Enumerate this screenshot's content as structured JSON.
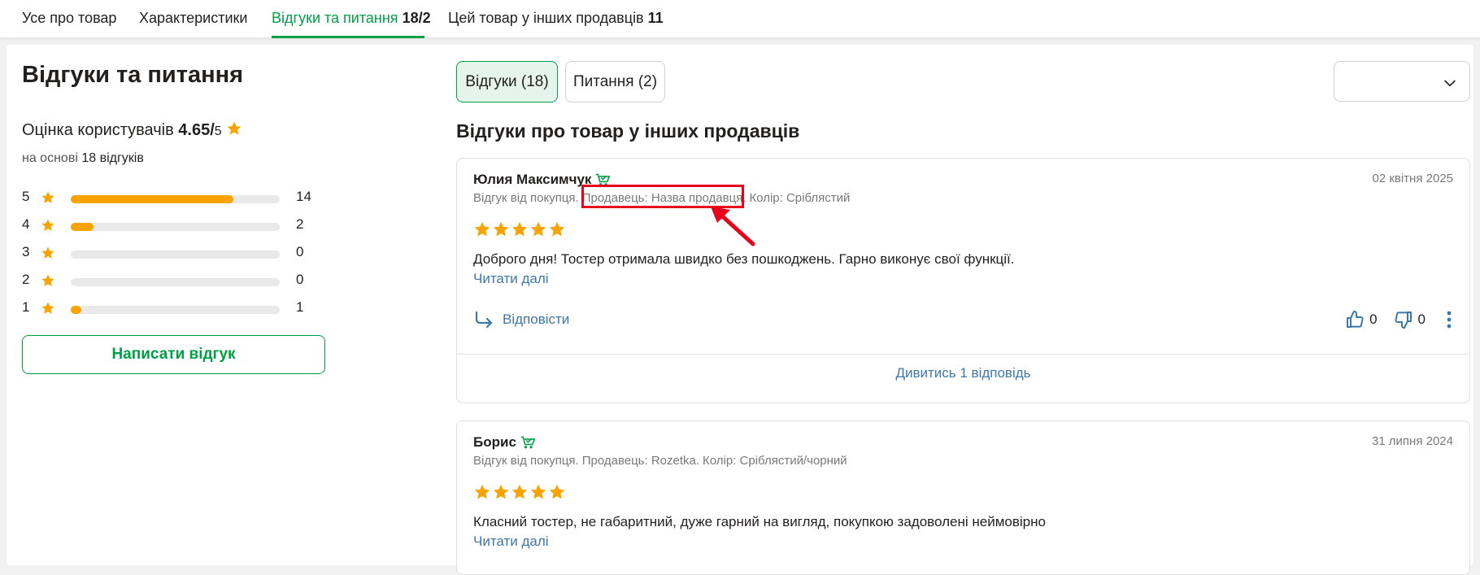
{
  "tabs": [
    {
      "label": "Усе про товар",
      "count": ""
    },
    {
      "label": "Характеристики",
      "count": ""
    },
    {
      "label": "Відгуки та питання",
      "count": "18/2"
    },
    {
      "label": "Цей товар у інших продавців",
      "count": "11"
    }
  ],
  "summary": {
    "title": "Відгуки та питання",
    "rating_label": "Оцінка користувачів",
    "rating_value": "4.65/",
    "rating_max": "5",
    "basis_prefix": "на основі",
    "basis_count": "18 відгуків",
    "distribution": [
      {
        "stars": "5",
        "count": "14",
        "fraction": 0.78
      },
      {
        "stars": "4",
        "count": "2",
        "fraction": 0.11
      },
      {
        "stars": "3",
        "count": "0",
        "fraction": 0
      },
      {
        "stars": "2",
        "count": "0",
        "fraction": 0
      },
      {
        "stars": "1",
        "count": "1",
        "fraction": 0.05
      }
    ],
    "write_button": "Написати відгук"
  },
  "filters": {
    "reviews": "Відгуки (18)",
    "questions": "Питання (2)"
  },
  "section_title": "Відгуки про товар у інших продавців",
  "reviews": [
    {
      "author": "Юлия Максимчук",
      "date": "02 квітня 2025",
      "meta_purchase": "Відгук від покупця.",
      "meta_seller": "Продавець: Назва продавця.",
      "meta_color": "Колір: Сріблястий",
      "rating": 5,
      "text": "Доброго дня! Тостер отримала швидко без пошкоджень. Гарно виконує свої функції.",
      "read_more": "Читати далі",
      "reply_label": "Відповісти",
      "likes": "0",
      "dislikes": "0",
      "view_replies": "Дивитись 1 відповідь"
    },
    {
      "author": "Борис",
      "date": "31 липня 2024",
      "meta_purchase": "Відгук від покупця.",
      "meta_seller": "Продавець: Rozetka.",
      "meta_color": "Колір: Сріблястий/чорний",
      "rating": 5,
      "text": "Класний тостер, не габаритний, дуже гарний на вигляд, покупкою задоволені неймовірно",
      "read_more": "Читати далі"
    }
  ],
  "colors": {
    "accent_green": "#00a046",
    "star_orange": "#f8a300",
    "link_blue": "#3e77aa",
    "highlight_red": "#e8001c"
  }
}
